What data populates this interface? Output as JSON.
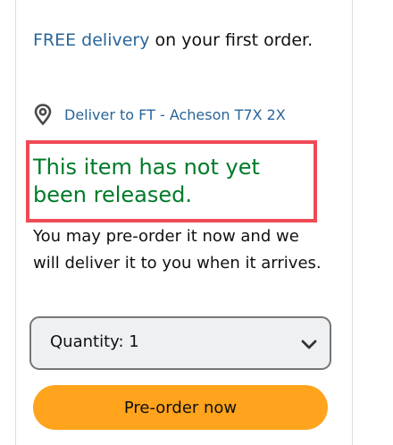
{
  "delivery": {
    "link_text": "FREE delivery",
    "rest_text": " on your first order."
  },
  "location": {
    "icon": "map-pin-icon",
    "text": "Deliver to FT - Acheson T7X 2X"
  },
  "availability": {
    "status": "This item has not yet been released.",
    "note": "You may pre-order it now and we will deliver it to you when it arrives.",
    "status_color": "#007a2a",
    "highlight_color": "#ef4a55"
  },
  "quantity": {
    "label": "Quantity:",
    "value": "1",
    "icon": "chevron-down-icon"
  },
  "preorder": {
    "label": "Pre-order now",
    "color": "#ffa41c"
  },
  "colors": {
    "link": "#2a6599",
    "text": "#0f1111"
  }
}
